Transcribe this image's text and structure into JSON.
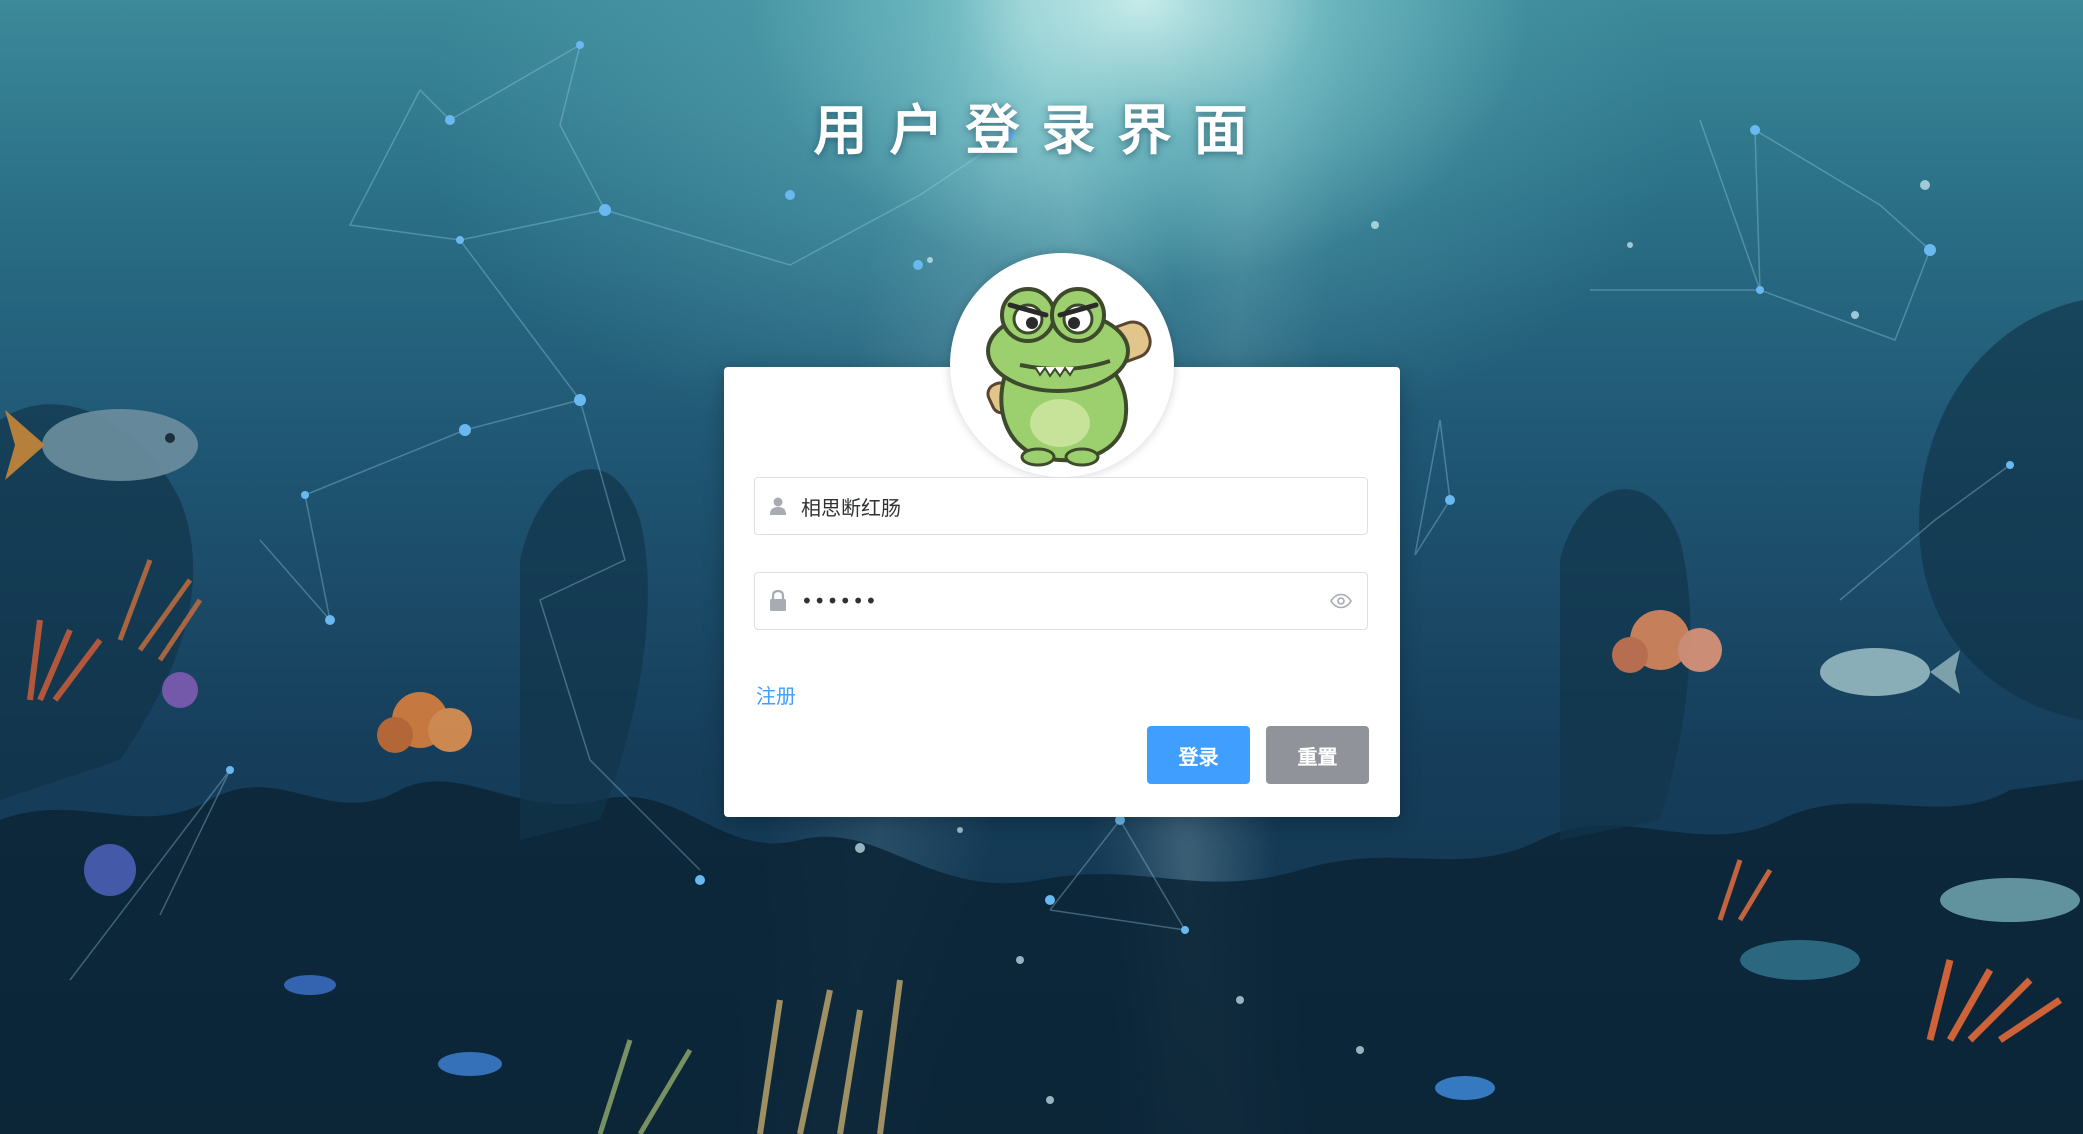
{
  "page": {
    "title": "用户登录界面"
  },
  "login_form": {
    "avatar_icon": "crocodile-mascot-avatar",
    "username": {
      "icon": "user-icon",
      "value": "相思断红肠"
    },
    "password": {
      "icon": "lock-icon",
      "value": "••••••",
      "toggle_icon": "eye-icon"
    },
    "register_link": "注册",
    "login_button": "登录",
    "reset_button": "重置"
  },
  "colors": {
    "primary": "#409eff",
    "reset_button": "#909399",
    "card_bg": "#ffffff",
    "title": "#ffffff",
    "background_deep": "#163f5c"
  }
}
